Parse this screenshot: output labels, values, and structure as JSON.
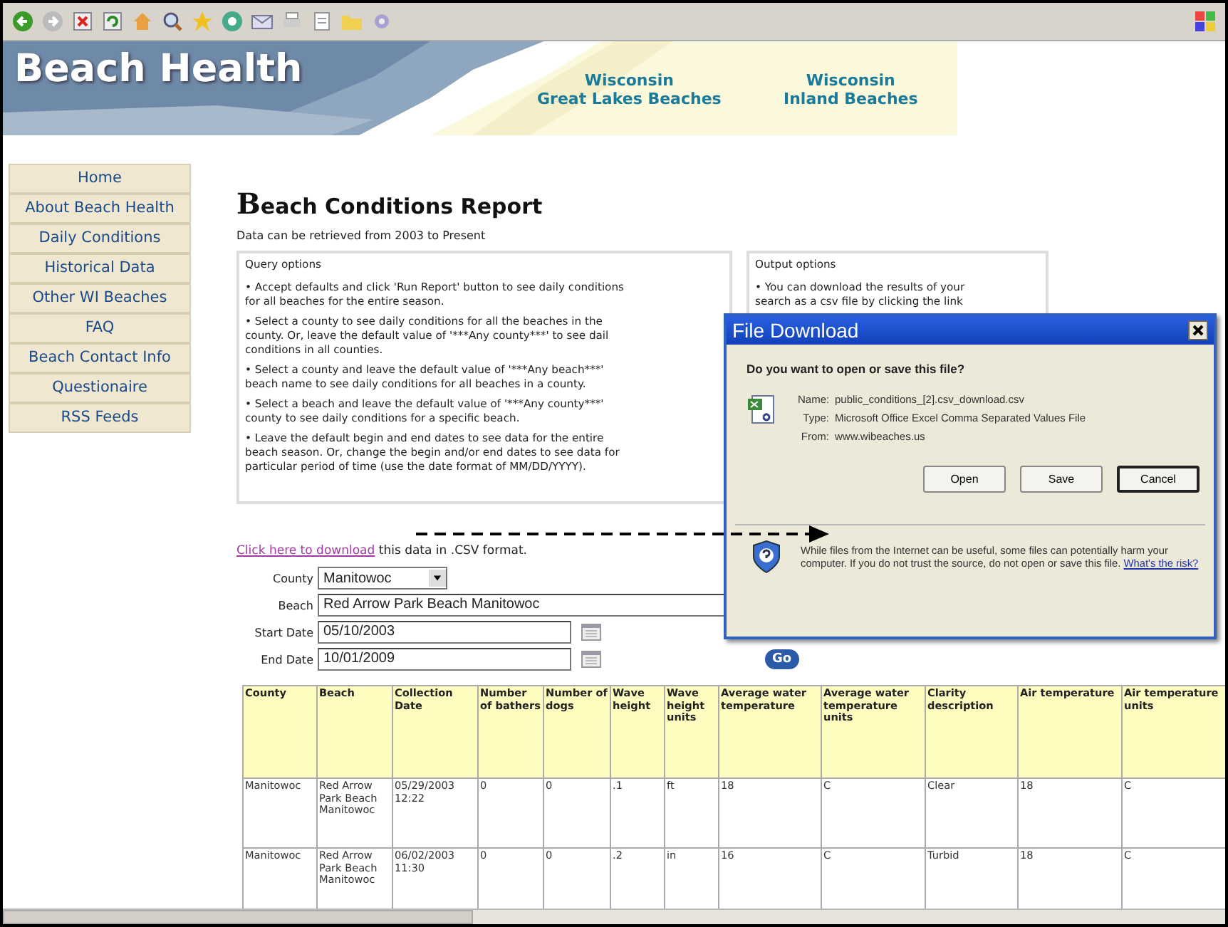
{
  "banner": {
    "title": "Beach Health",
    "links": [
      [
        "Wisconsin",
        "Great Lakes Beaches"
      ],
      [
        "Wisconsin",
        "Inland Beaches"
      ]
    ]
  },
  "nav": [
    "Home",
    "About Beach Health",
    "Daily Conditions",
    "Historical Data",
    "Other WI Beaches",
    "FAQ",
    "Beach Contact Info",
    "Questionaire",
    "RSS Feeds"
  ],
  "report": {
    "title": "Beach Conditions Report",
    "note": "Data can be retrieved from 2003 to Present"
  },
  "query_options": {
    "heading": "Query options",
    "bullets": [
      [
        "•  Accept defaults and click 'Run Report' button to see daily conditions",
        "for all beaches for the entire season."
      ],
      [
        "•  Select a county to see daily conditions for all the beaches in the",
        "county. Or, leave the default value of '***Any county***' to see dail",
        "conditions in all counties."
      ],
      [
        "•  Select a county and leave the default value of '***Any beach***'",
        "beach name to see daily conditions for all beaches in a county."
      ],
      [
        "•  Select a beach and leave the default value of '***Any county***'",
        "county to see daily conditions for a specific beach."
      ],
      [
        "•  Leave the default begin and end dates to see data for the entire",
        "beach season. Or, change the begin and/or end dates to see data for",
        "particular period of time (use the date format of MM/DD/YYYY)."
      ]
    ]
  },
  "output_options": {
    "heading": "Output options",
    "lines": [
      "•  You can download the results of your",
      "search as a csv file by clicking the link"
    ]
  },
  "download": {
    "link": "Click here to download",
    "text": " this data in .CSV format."
  },
  "form": {
    "county": {
      "label": "County",
      "value": "Manitowoc"
    },
    "beach": {
      "label": "Beach",
      "value": "Red Arrow Park Beach Manitowoc"
    },
    "start_date": {
      "label": "Start Date",
      "value": "05/10/2003"
    },
    "end_date": {
      "label": "End Date",
      "value": "10/01/2009"
    },
    "go": "Go"
  },
  "table": {
    "columns": [
      "County",
      "Beach",
      "Collection Date",
      "Number of bathers",
      "Number of dogs",
      "Wave height",
      "Wave height units",
      "Average water temperature",
      "Average water temperature units",
      "Clarity description",
      "Air temperature",
      "Air temperature units"
    ],
    "rows": [
      [
        "Manitowoc",
        "Red Arrow Park Beach Manitowoc",
        "05/29/2003 12:22",
        "0",
        "0",
        ".1",
        "ft",
        "18",
        "C",
        "Clear",
        "18",
        "C"
      ],
      [
        "Manitowoc",
        "Red Arrow Park Beach Manitowoc",
        "06/02/2003 11:30",
        "0",
        "0",
        ".2",
        "in",
        "16",
        "C",
        "Turbid",
        "18",
        "C"
      ]
    ]
  },
  "dialog": {
    "title": "File Download",
    "question": "Do you want to open or save this file?",
    "fields": [
      {
        "label": "Name:",
        "value": "public_conditions_[2].csv_download.csv"
      },
      {
        "label": "Type:",
        "value": "Microsoft Office Excel Comma Separated Values File"
      },
      {
        "label": "From:",
        "value": "www.wibeaches.us"
      }
    ],
    "buttons": [
      {
        "label": "Open",
        "default": false
      },
      {
        "label": "Save",
        "default": false
      },
      {
        "label": "Cancel",
        "default": true
      }
    ],
    "warning": "While files from the Internet can be useful, some files can potentially harm your computer. If you do not trust the source, do not open or save this file.",
    "risk_link": "What's the risk?"
  }
}
